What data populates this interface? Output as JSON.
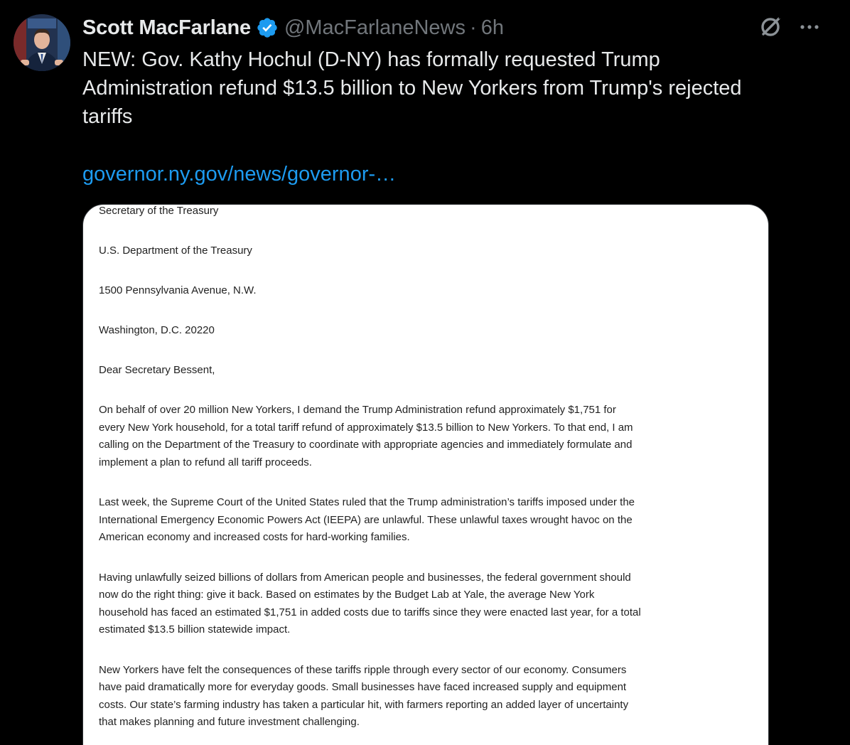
{
  "tweet": {
    "author_name": "Scott MacFarlane",
    "handle": "@MacFarlaneNews",
    "separator": "·",
    "time": "6h",
    "text_lines": [
      "NEW:  Gov. Kathy Hochul (D-NY) has formally requested Trump",
      "Administration refund $13.5 billion to New Yorkers from Trump's rejected",
      "tariffs"
    ],
    "link": "governor.ny.gov/news/governor-…"
  },
  "icons": {
    "verified": "verified-badge-icon",
    "grok": "grok-icon",
    "more": "more-icon",
    "accent_color": "#1d9bf0"
  },
  "document": {
    "address": [
      "Secretary of the Treasury",
      "U.S. Department of the Treasury",
      "1500 Pennsylvania Avenue, N.W.",
      "Washington, D.C. 20220"
    ],
    "salutation": "Dear Secretary Bessent,",
    "paragraphs": [
      [
        "On behalf of over 20 million New Yorkers, I demand the Trump Administration refund approximately $1,751 for",
        "every New York household, for a total tariff refund of approximately $13.5 billion to New Yorkers. To that end, I am",
        "calling on the Department of the Treasury to coordinate with appropriate agencies and immediately formulate and",
        "implement a plan to refund all tariff proceeds."
      ],
      [
        "Last week, the Supreme Court of the United States ruled that the Trump administration’s tariffs imposed under the",
        "International Emergency Economic Powers Act (IEEPA) are unlawful. These unlawful taxes wrought havoc on the",
        "American economy and increased costs for hard-working families."
      ],
      [
        "Having unlawfully seized billions of dollars from American people and businesses, the federal government should",
        "now do the right thing: give it back. Based on estimates by the Budget Lab at Yale, the average New York",
        "household has faced an estimated $1,751 in added costs due to tariffs since they were enacted last year, for a total",
        "estimated $13.5 billion statewide impact."
      ],
      [
        "New Yorkers have felt the consequences of these tariffs ripple through every sector of our economy. Consumers",
        "have paid dramatically more for everyday goods. Small businesses have faced increased supply and equipment",
        "costs. Our state’s farming industry has taken a particular hit, with farmers reporting an added layer of uncertainty",
        "that makes planning and future investment challenging."
      ]
    ]
  }
}
